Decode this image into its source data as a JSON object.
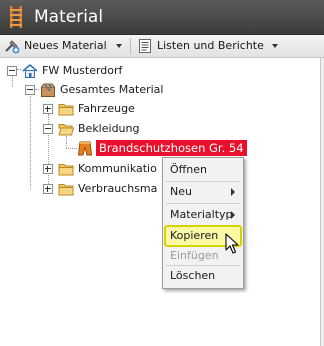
{
  "window": {
    "title": "Material",
    "icon": "ladder-icon"
  },
  "toolbar": {
    "new_material_label": "Neues Material",
    "lists_reports_label": "Listen und Berichte"
  },
  "tree": {
    "nodes": [
      {
        "label": "FW Musterdorf",
        "icon": "house-icon",
        "state": "expanded"
      },
      {
        "label": "Gesamtes Material",
        "icon": "material-box-icon",
        "state": "expanded"
      },
      {
        "label": "Fahrzeuge",
        "icon": "folder-icon",
        "state": "collapsed"
      },
      {
        "label": "Bekleidung",
        "icon": "folder-open-icon",
        "state": "expanded"
      },
      {
        "label": "Brandschutzhosen Gr. 54",
        "icon": "trousers-icon",
        "state": "selected"
      },
      {
        "label": "Kommunikatio",
        "icon": "folder-icon",
        "state": "collapsed"
      },
      {
        "label": "Verbrauchsma",
        "icon": "folder-icon",
        "state": "collapsed"
      }
    ]
  },
  "context_menu": {
    "items": [
      {
        "label": "Öffnen",
        "enabled": true
      },
      {
        "label": "Neu",
        "enabled": true,
        "submenu": true
      },
      {
        "label": "Materialtyp",
        "enabled": true,
        "submenu": true
      },
      {
        "label": "Kopieren",
        "enabled": true,
        "highlighted": true
      },
      {
        "label": "Einfügen",
        "enabled": false
      },
      {
        "label": "Löschen",
        "enabled": true
      }
    ]
  },
  "colors": {
    "titlebar": "#4a4a4a",
    "selection": "#e8102a",
    "highlight": "#fbf9a6",
    "highlight_border": "#d6d200"
  }
}
